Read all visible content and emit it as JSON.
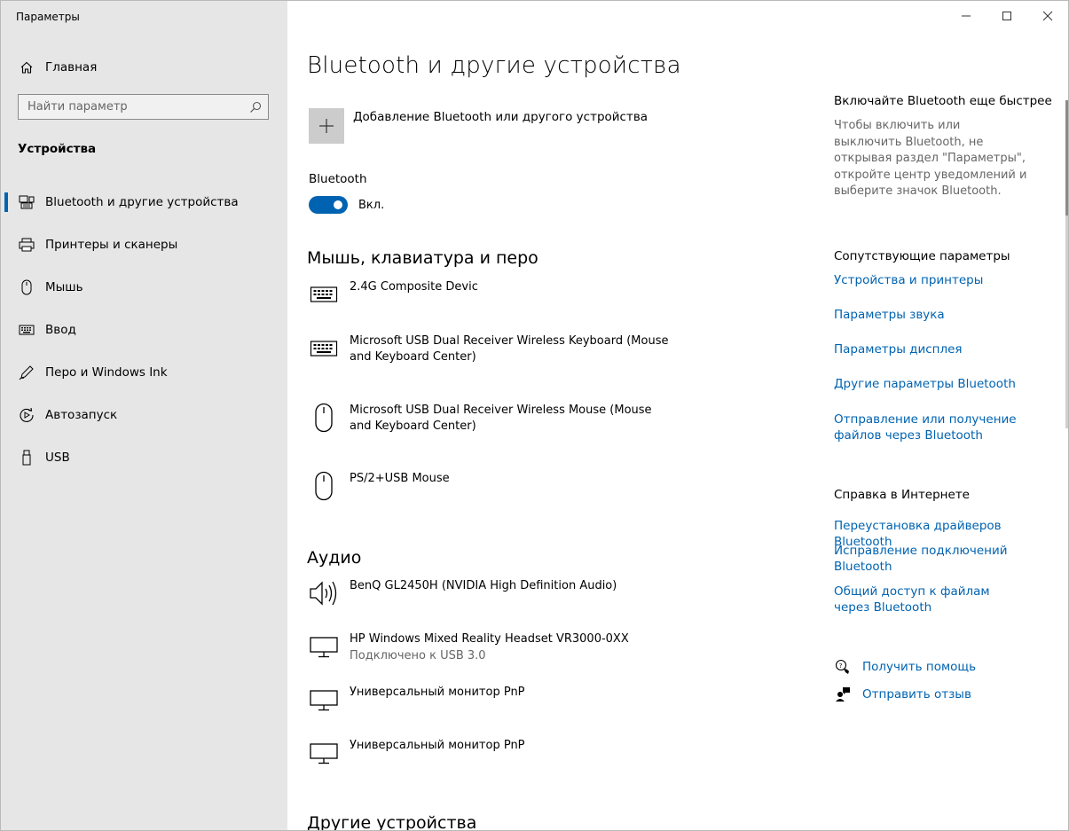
{
  "window": {
    "title": "Параметры",
    "controls": {
      "minimize": "—",
      "maximize": "☐",
      "close": "✕"
    }
  },
  "sidebar": {
    "home_label": "Главная",
    "search_placeholder": "Найти параметр",
    "section_title": "Устройства",
    "items": [
      {
        "label": "Bluetooth и другие устройства",
        "icon": "bluetooth-devices-icon",
        "active": true
      },
      {
        "label": "Принтеры и сканеры",
        "icon": "printer-icon"
      },
      {
        "label": "Мышь",
        "icon": "mouse-icon"
      },
      {
        "label": "Ввод",
        "icon": "keyboard-icon"
      },
      {
        "label": "Перо и Windows Ink",
        "icon": "pen-icon"
      },
      {
        "label": "Автозапуск",
        "icon": "autoplay-icon"
      },
      {
        "label": "USB",
        "icon": "usb-icon"
      }
    ]
  },
  "main": {
    "page_title": "Bluetooth и другие устройства",
    "add_device_label": "Добавление Bluetooth или другого устройства",
    "bluetooth_label": "Bluetooth",
    "bluetooth_state": "Вкл.",
    "bluetooth_on": true,
    "groups": {
      "mouse_keyboard_pen": {
        "title": "Мышь, клавиатура и перо",
        "devices": [
          {
            "name": "2.4G Composite Devic",
            "icon": "keyboard-icon"
          },
          {
            "name": "Microsoft USB Dual Receiver Wireless Keyboard (Mouse and Keyboard Center)",
            "icon": "keyboard-icon"
          },
          {
            "name": "Microsoft USB Dual Receiver Wireless Mouse (Mouse and Keyboard Center)",
            "icon": "mouse-icon"
          },
          {
            "name": "PS/2+USB Mouse",
            "icon": "mouse-icon"
          }
        ]
      },
      "audio": {
        "title": "Аудио",
        "devices": [
          {
            "name": "BenQ GL2450H (NVIDIA High Definition Audio)",
            "icon": "speaker-icon"
          },
          {
            "name": "HP Windows Mixed Reality Headset VR3000-0XX",
            "status": "Подключено к USB 3.0",
            "icon": "monitor-icon"
          },
          {
            "name": "Универсальный монитор PnP",
            "icon": "monitor-icon"
          },
          {
            "name": "Универсальный монитор PnP",
            "icon": "monitor-icon"
          }
        ]
      },
      "other": {
        "title": "Другие устройства"
      }
    }
  },
  "aside": {
    "tip_title": "Включайте Bluetooth еще быстрее",
    "tip_text": "Чтобы включить или выключить Bluetooth, не открывая раздел \"Параметры\", откройте центр уведомлений и выберите значок Bluetooth.",
    "related_title": "Сопутствующие параметры",
    "related_links": [
      "Устройства и принтеры",
      "Параметры звука",
      "Параметры дисплея",
      "Другие параметры Bluetooth",
      "Отправление или получение файлов через Bluetooth"
    ],
    "web_help_title": "Справка в Интернете",
    "web_help_links": [
      "Переустановка драйверов Bluetooth",
      "Исправление подключений Bluetooth",
      "Общий доступ к файлам через Bluetooth"
    ],
    "get_help": "Получить помощь",
    "send_feedback": "Отправить отзыв"
  }
}
